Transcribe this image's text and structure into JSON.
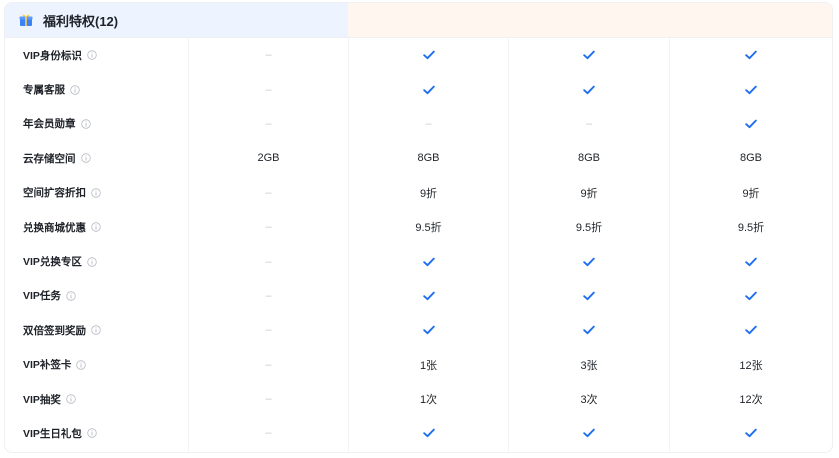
{
  "section": {
    "title": "福利特权(12)",
    "icon": "gift-icon",
    "accent": "#1e6ef0",
    "left_bg": "#eef4ff",
    "right_bg": "#fff6ef"
  },
  "rows": [
    {
      "label": "VIP身份标识",
      "cells": [
        "–",
        "check",
        "check",
        "check"
      ]
    },
    {
      "label": "专属客服",
      "cells": [
        "–",
        "check",
        "check",
        "check"
      ]
    },
    {
      "label": "年会员勋章",
      "cells": [
        "–",
        "–",
        "–",
        "check"
      ]
    },
    {
      "label": "云存储空间",
      "cells": [
        "2GB",
        "8GB",
        "8GB",
        "8GB"
      ]
    },
    {
      "label": "空间扩容折扣",
      "cells": [
        "–",
        "9折",
        "9折",
        "9折"
      ]
    },
    {
      "label": "兑换商城优惠",
      "cells": [
        "–",
        "9.5折",
        "9.5折",
        "9.5折"
      ]
    },
    {
      "label": "VIP兑换专区",
      "cells": [
        "–",
        "check",
        "check",
        "check"
      ]
    },
    {
      "label": "VIP任务",
      "cells": [
        "–",
        "check",
        "check",
        "check"
      ]
    },
    {
      "label": "双倍签到奖励",
      "cells": [
        "–",
        "check",
        "check",
        "check"
      ]
    },
    {
      "label": "VIP补签卡",
      "cells": [
        "–",
        "1张",
        "3张",
        "12张"
      ]
    },
    {
      "label": "VIP抽奖",
      "cells": [
        "–",
        "1次",
        "3次",
        "12次"
      ]
    },
    {
      "label": "VIP生日礼包",
      "cells": [
        "–",
        "check",
        "check",
        "check"
      ]
    }
  ]
}
